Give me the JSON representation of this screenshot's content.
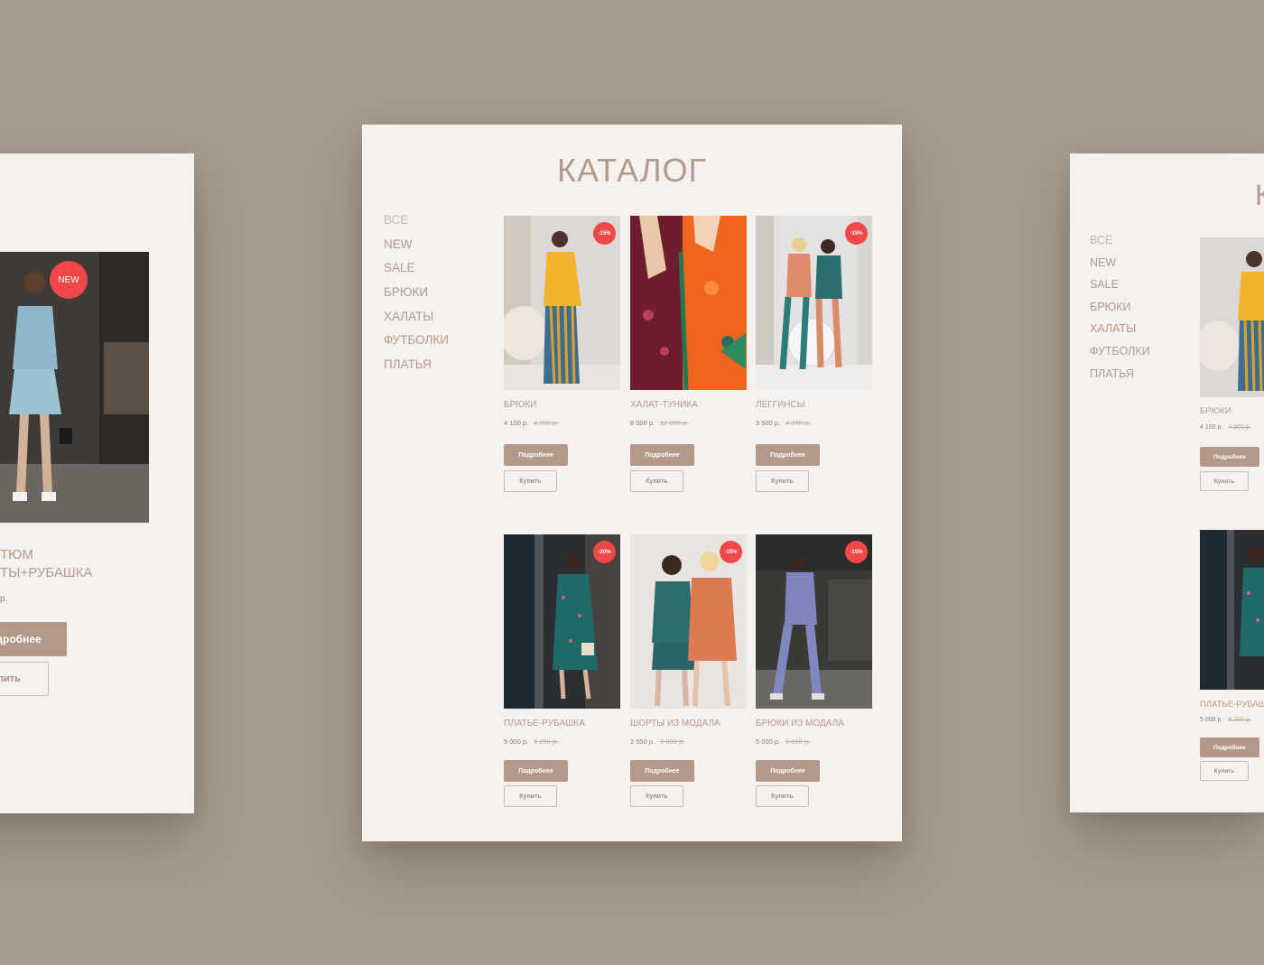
{
  "catalog": {
    "title": "КАТАЛОГ"
  },
  "nav": [
    "ВСЕ",
    "NEW",
    "SALE",
    "БРЮКИ",
    "ХАЛАТЫ",
    "ФУТБОЛКИ",
    "ПЛАТЬЯ"
  ],
  "buttons": {
    "more": "Подробнее",
    "buy": "Купить"
  },
  "products": [
    {
      "name": "БРЮКИ",
      "price": "4 100 р.",
      "old_price": "4 900 р.",
      "badge": "-15%"
    },
    {
      "name": "ХАЛАТ-ТУНИКА",
      "price": "8 000 р.",
      "old_price": "12 000 р.",
      "badge": ""
    },
    {
      "name": "ЛЕГГИНСЫ",
      "price": "3 500 р.",
      "old_price": "4 200 р.",
      "badge": "-15%"
    },
    {
      "name": "ПЛАТЬЕ-РУБАШКА",
      "price": "5 000 р.",
      "old_price": "6 250 р.",
      "badge": "-20%"
    },
    {
      "name": "ШОРТЫ ИЗ МОДАЛА",
      "price": "2 550 р.",
      "old_price": "3 000 р.",
      "badge": "-15%"
    },
    {
      "name": "БРЮКИ ИЗ МОДАЛА",
      "price": "5 000 р.",
      "old_price": "5 900 р.",
      "badge": "-15%"
    }
  ],
  "left_card": {
    "badge": "NEW",
    "title_line1": "ТЮМ",
    "title_line2": "ТЫ+РУБАШКА",
    "price": "р.",
    "more": "одробнее",
    "buy": "упить"
  },
  "right_card": {
    "title": "К",
    "products": [
      {
        "name": "БРЮКИ",
        "price": "4 100 р.",
        "old_price": "4 900 р."
      },
      {
        "name": "ПЛАТЬЕ-РУБАШКА",
        "price": "5 000 р.",
        "old_price": "6 250 р."
      }
    ]
  },
  "colors": {
    "background": "#a89c8f",
    "card": "#f5f1ef",
    "accent": "#b49889",
    "badge": "#f04848"
  }
}
